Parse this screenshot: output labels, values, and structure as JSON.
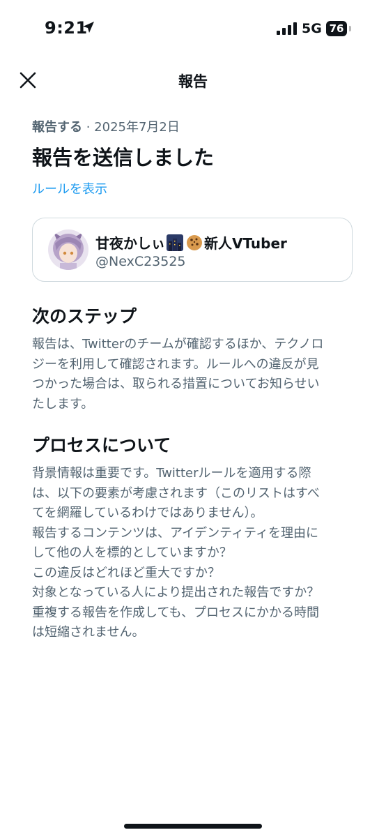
{
  "status_bar": {
    "time": "9:21",
    "network": "5G",
    "battery": "76"
  },
  "header": {
    "title": "報告",
    "close_icon": "close-icon"
  },
  "report": {
    "meta_label": "報告する",
    "meta_date": " · 2025年7月2日",
    "title": "報告を送信しました",
    "rules_link": "ルールを表示"
  },
  "account": {
    "display_name": "甘夜かしぃ",
    "display_suffix": "新人VTuber",
    "emojis": [
      "night-city-emoji",
      "cookie-emoji"
    ],
    "handle": "@NexC23525"
  },
  "next_steps": {
    "heading": "次のステップ",
    "lines": [
      "報告は、Twitterのチームが確認するほか、テクノロ",
      "ジーを利用して確認されます。ルールへの違反が見",
      "つかった場合は、取られる措置についてお知らせい",
      "たします。"
    ]
  },
  "process": {
    "heading": "プロセスについて",
    "lines": [
      "背景情報は重要です。Twitterルールを適用する際",
      "は、以下の要素が考慮されます（このリストはすべ",
      "てを網羅しているわけではありません）。",
      "報告するコンテンツは、アイデンティティを理由に",
      "して他の人を標的としていますか？",
      "この違反はどれほど重大ですか？",
      "対象となっている人により提出された報告ですか？",
      "重複する報告を作成しても、プロセスにかかる時間",
      "は短縮されません。"
    ]
  },
  "colors": {
    "text": "#0f1419",
    "secondary": "#536471",
    "link": "#1d9bf0",
    "border": "#cfd9de"
  }
}
